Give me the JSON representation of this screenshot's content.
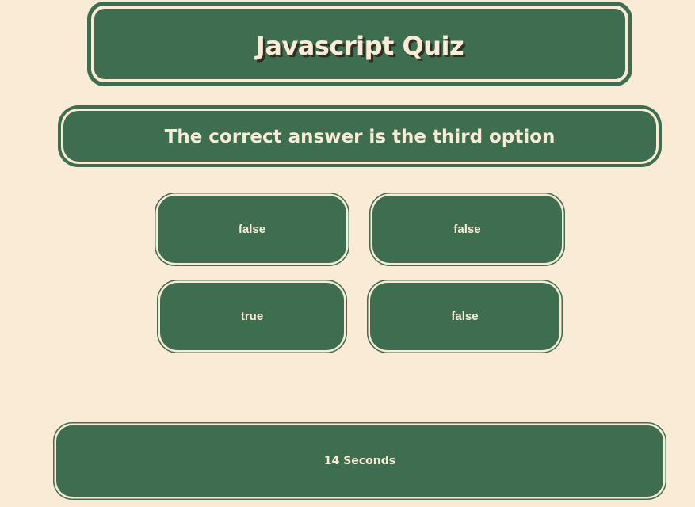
{
  "quiz": {
    "title": "Javascript Quiz",
    "question": "The correct answer is the third option",
    "answers": [
      {
        "label": "false"
      },
      {
        "label": "false"
      },
      {
        "label": "true"
      },
      {
        "label": "false"
      }
    ],
    "timer": "14 Seconds"
  },
  "colors": {
    "background": "#faebd7",
    "panel": "#3e6e4f",
    "text": "#faebd7"
  }
}
